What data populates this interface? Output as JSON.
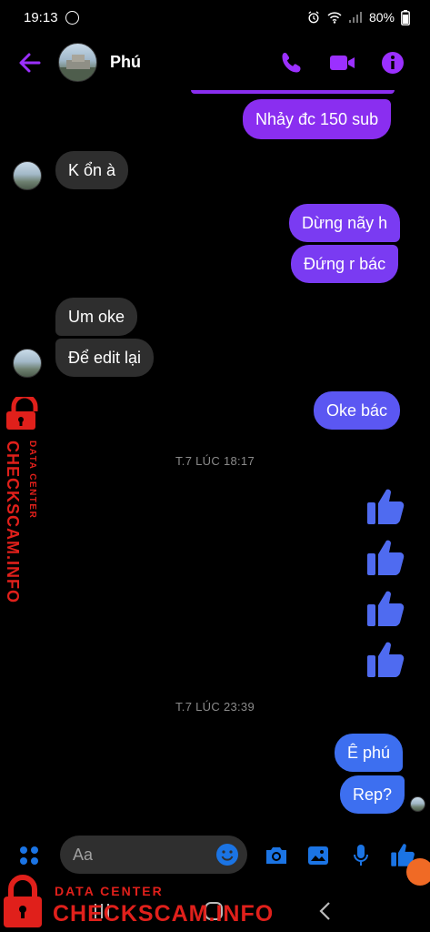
{
  "status_bar": {
    "time": "19:13",
    "battery": "80%"
  },
  "header": {
    "contact_name": "Phú"
  },
  "messages": [
    {
      "id": "m1",
      "text": "Nhảy đc 150 sub"
    },
    {
      "id": "m2",
      "text": "K ổn à"
    },
    {
      "id": "m3",
      "text": "Dừng nãy h"
    },
    {
      "id": "m4",
      "text": "Đứng r bác"
    },
    {
      "id": "m5",
      "text": "Um oke"
    },
    {
      "id": "m6",
      "text": "Để edit lại"
    },
    {
      "id": "m7",
      "text": "Oke bác"
    },
    {
      "id": "m8",
      "text": "Ê phú"
    },
    {
      "id": "m9",
      "text": "Rep?"
    }
  ],
  "timestamps": [
    "T.7 LÚC 18:17",
    "T.7 LÚC 23:39"
  ],
  "composer": {
    "placeholder": "Aa"
  },
  "icons": {
    "accent_purple": "#9b30ff",
    "accent_blue": "#1b74e4",
    "thumb_color": "#4f6bf0"
  },
  "watermark": {
    "label": "DATA CENTER",
    "brand": "CHECKSCAM.INFO"
  }
}
